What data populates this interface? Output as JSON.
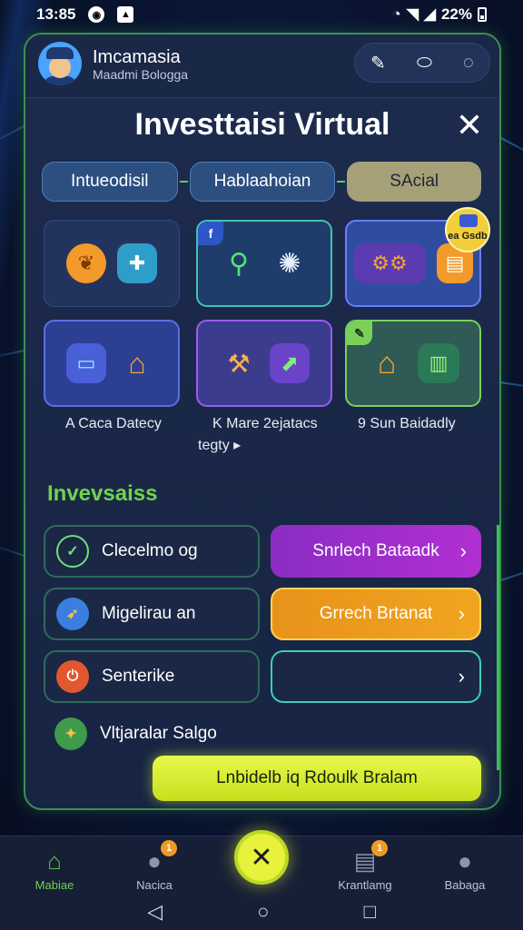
{
  "status_bar": {
    "time": "13:85",
    "battery": "22%"
  },
  "profile": {
    "name": "Imcamasia",
    "subtitle": "Maadmi Bologga"
  },
  "dialog": {
    "title": "Investtaisi Virtual",
    "close_symbol": "✕"
  },
  "tabs": [
    {
      "label": "Intueodisil"
    },
    {
      "label": "Hablaahoian"
    },
    {
      "label": "SAcial"
    }
  ],
  "cards": {
    "badge_text": "ea Gsdb",
    "corner_f": "f"
  },
  "card_captions": [
    {
      "text": "A Caca Datecy"
    },
    {
      "text": "K Mare 2ejatacs"
    },
    {
      "text": "tegty ▸"
    },
    {
      "text": "9 Sun Baidadly"
    }
  ],
  "section": {
    "title": "Invevsaiss"
  },
  "list_rows": [
    {
      "left_label": "Clecelmo og",
      "right_label": "Snrlech Bataadk"
    },
    {
      "left_label": "Migelirau an",
      "right_label": "Grrech Brtanat"
    },
    {
      "left_label": "Senterike",
      "right_label": ""
    },
    {
      "left_label": "Vltjaralar Salgo"
    }
  ],
  "cta": {
    "label": "Lnbidelb iq Rdoulk Bralam"
  },
  "bottom_nav": [
    {
      "label": "Mabiae",
      "active": true
    },
    {
      "label": "Nacica",
      "badge": "1"
    },
    {
      "label": "Krantlamg",
      "badge": "1"
    },
    {
      "label": "Babaga"
    }
  ],
  "colors": {
    "accent_green": "#72d24e",
    "cta_yellow": "#e6f23c",
    "panel_border": "#3e8f4f"
  }
}
